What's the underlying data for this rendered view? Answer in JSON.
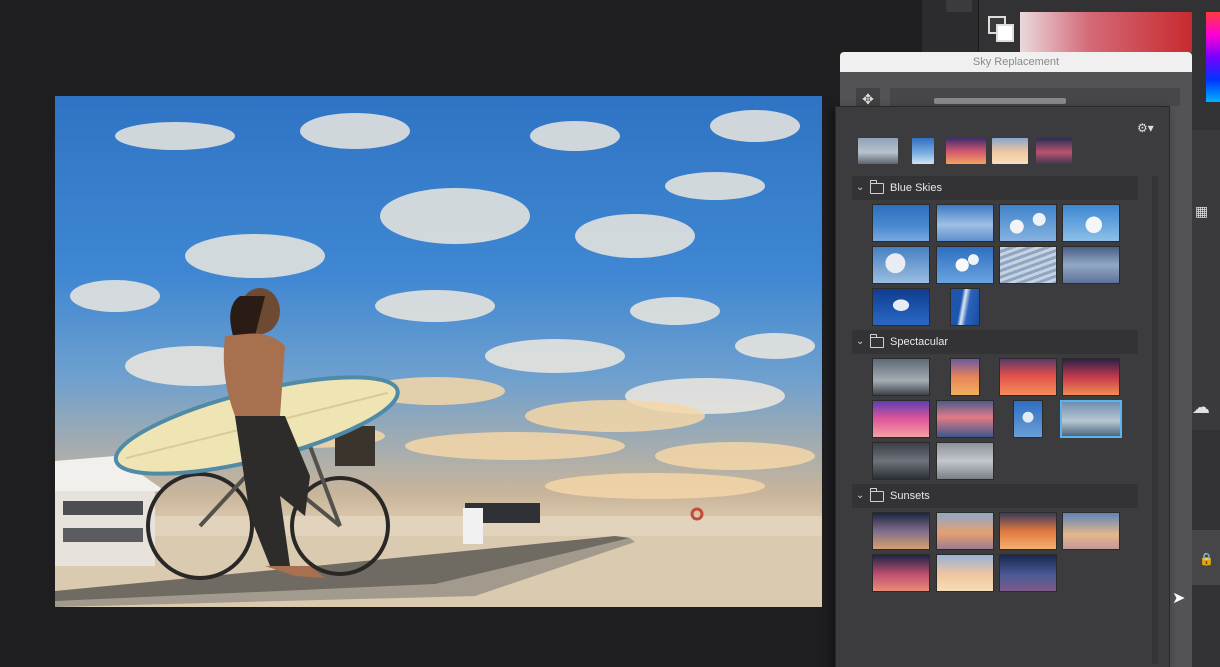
{
  "dialog": {
    "title": "Sky Replacement"
  },
  "colors": {
    "selection": "#5ab5ee",
    "panel": "#3c3c3e",
    "header": "#333335"
  },
  "recent_skies": [
    {
      "name": "recent-sky-1",
      "fill": "linear-gradient(180deg,#8ea2b8 0%,#b9c2cc 55%,#5d6470 100%)"
    },
    {
      "name": "recent-sky-2",
      "fill": "linear-gradient(180deg,#2f6fc2 0%,#7fb0e2 60%,#d3e4f4 100%)"
    },
    {
      "name": "recent-sky-3",
      "fill": "linear-gradient(180deg,#3b2d6a 0%,#d0556e 50%,#f4a260 100%)"
    },
    {
      "name": "recent-sky-4",
      "fill": "linear-gradient(180deg,#89a6cc 0%,#f1c9a0 55%,#f6e0c0 100%)"
    },
    {
      "name": "recent-sky-5",
      "fill": "linear-gradient(180deg,#2a2e52 0%,#b85470 55%,#40374f 100%)"
    }
  ],
  "groups": [
    {
      "label": "Blue Skies",
      "chevron": "⌄",
      "thumbs": [
        {
          "name": "sky-blue-clear",
          "fill": "linear-gradient(180deg,#2c6fbf 0%,#4b8ad1 60%,#78a9de 100%)"
        },
        {
          "name": "sky-blue-wispy",
          "fill": "linear-gradient(180deg,#3b7ac6 0%,#9fc0e4 55%,#5f90cf 100%)"
        },
        {
          "name": "sky-blue-scattered",
          "fill": "radial-gradient(circle at 30% 60%,#f2f4f7 0 15%,transparent 16%),radial-gradient(circle at 70% 40%,#eef1f5 0 14%,transparent 15%),linear-gradient(180deg,#3f82cc,#86b3e0)"
        },
        {
          "name": "sky-blue-puffy",
          "fill": "radial-gradient(circle at 55% 55%,#f4f6f8 0 22%,transparent 23%),linear-gradient(180deg,#3e86d0,#8cc0ea)"
        },
        {
          "name": "sky-blue-cumulus",
          "fill": "radial-gradient(circle at 40% 45%,#e8edf3 0 25%,transparent 26%),linear-gradient(180deg,#4780c2,#9bbde0)"
        },
        {
          "name": "sky-blue-cotton",
          "fill": "radial-gradient(circle at 45% 50%,#f8fafc 0 18%,transparent 19%),radial-gradient(circle at 65% 35%,#eef3f8 0 12%,transparent 13%),linear-gradient(180deg,#2d6fc0,#6aa3de)"
        },
        {
          "name": "sky-blue-mackerel",
          "fill": "repeating-linear-gradient(160deg,#c7d2df 0 3px,#8ea6c4 3px 6px)"
        },
        {
          "name": "sky-blue-hazy",
          "fill": "linear-gradient(180deg,#4a5f86 0%,#93a8c7 50%,#5d7397 100%)"
        },
        {
          "name": "sky-blue-deep",
          "fill": "radial-gradient(ellipse at 50% 45%,#e5ecf5 0 20%,transparent 21%),linear-gradient(180deg,#0f3d8f,#2a68c6)"
        },
        {
          "name": "sky-blue-streak",
          "fill": "linear-gradient(100deg,#1d56ae 0 35%,#dfe8f3 45%,#2a63bb 60%,#1a4c9f 100%)",
          "narrow": true
        }
      ]
    },
    {
      "label": "Spectacular",
      "chevron": "⌄",
      "thumbs": [
        {
          "name": "sky-spectacular-rainbow",
          "fill": "linear-gradient(180deg,#5d6a78 0%,#a5adb4 60%,#3d4248 100%)"
        },
        {
          "name": "sky-spectacular-orange-streak",
          "fill": "linear-gradient(180deg,#6c5aa0 0%,#e8845a 50%,#f0b15c 100%)",
          "narrow": true
        },
        {
          "name": "sky-spectacular-red-dusk",
          "fill": "linear-gradient(180deg,#5a3a6a 0%,#e04e48 45%,#f7905c 100%)"
        },
        {
          "name": "sky-spectacular-fire",
          "fill": "linear-gradient(180deg,#2b2146 0%,#c53a4f 50%,#f28c52 100%)"
        },
        {
          "name": "sky-spectacular-violet",
          "fill": "linear-gradient(180deg,#5b3fb0 0%,#e0569a 50%,#f4a0a4 100%)"
        },
        {
          "name": "sky-spectacular-pink-bands",
          "fill": "linear-gradient(180deg,#4a5c8c 0%,#e47a86 45%,#3f588c 100%)"
        },
        {
          "name": "sky-spectacular-blue-puffs",
          "fill": "radial-gradient(circle at 50% 45%,#e2ecf6 0 22%,transparent 23%),linear-gradient(180deg,#2f6ec0,#6a9fd8)",
          "narrow": true
        },
        {
          "name": "sky-spectacular-calm-sea",
          "fill": "linear-gradient(180deg,#6f8fae 0%,#b7c7d4 55%,#4d667e 100%)",
          "selected": true
        },
        {
          "name": "sky-spectacular-storm",
          "fill": "linear-gradient(180deg,#3b3f46 0%,#6d737c 50%,#2c2f34 100%)"
        },
        {
          "name": "sky-spectacular-overcast",
          "fill": "linear-gradient(180deg,#8d9299 0%,#c4c8cd 50%,#7a7f86 100%)"
        }
      ]
    },
    {
      "label": "Sunsets",
      "chevron": "⌄",
      "thumbs": [
        {
          "name": "sky-sunset-dusk",
          "fill": "linear-gradient(180deg,#1c2540 0%,#7f6d8c 50%,#d5a070 100%)"
        },
        {
          "name": "sky-sunset-golden",
          "fill": "linear-gradient(180deg,#8fa8c8 0%,#e3a070 55%,#a07c90 100%)"
        },
        {
          "name": "sky-sunset-orange",
          "fill": "linear-gradient(180deg,#3a3b5c 0%,#e07840 50%,#f4b070 100%)"
        },
        {
          "name": "sky-sunset-pastel",
          "fill": "linear-gradient(180deg,#5d84b8 0%,#e4b88c 60%,#c49898 100%)"
        },
        {
          "name": "sky-sunset-crimson",
          "fill": "linear-gradient(180deg,#1e2446 0%,#c25070 55%,#e88c78 100%)"
        },
        {
          "name": "sky-sunset-soft",
          "fill": "linear-gradient(180deg,#9ab2d6 0%,#f0c6a0 55%,#f6ddb8 100%)"
        },
        {
          "name": "sky-sunset-night",
          "fill": "linear-gradient(180deg,#182850 0%,#4b5a94 55%,#7e5a8a 100%)"
        }
      ]
    }
  ]
}
